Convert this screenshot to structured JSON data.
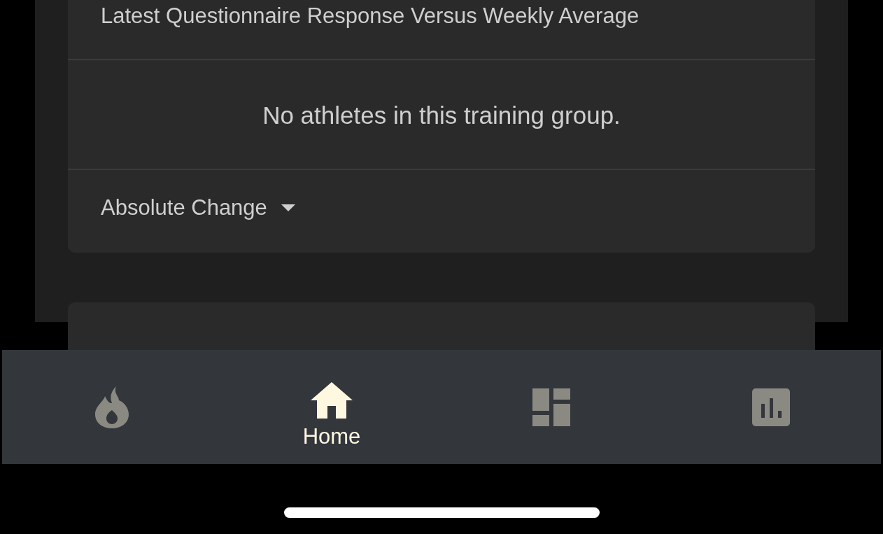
{
  "questionnaire_card": {
    "title": "Latest Questionnaire Response Versus Weekly Average",
    "message": "No athletes in this training group.",
    "dropdown": {
      "value": "Absolute Change"
    }
  },
  "bottom_nav": [
    {
      "kind": "flame",
      "selected": false
    },
    {
      "kind": "home",
      "label": "Home",
      "selected": true
    },
    {
      "kind": "dashboard",
      "selected": false
    },
    {
      "kind": "chart",
      "selected": false
    }
  ]
}
